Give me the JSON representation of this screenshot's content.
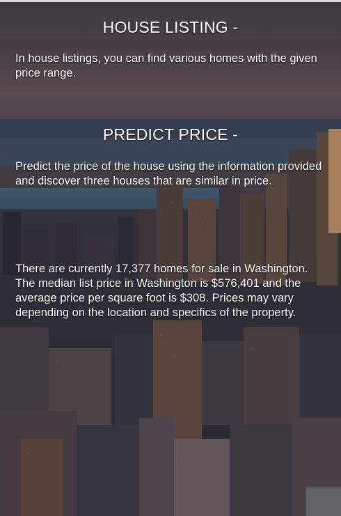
{
  "house_listing": {
    "heading": "HOUSE LISTING -",
    "description": "In house listings, you can find various homes with the given price range."
  },
  "predict_price": {
    "heading": "PREDICT PRICE -",
    "description": "Predict the price of the house using the information provided and discover three houses that are similar in price."
  },
  "market_info": {
    "text": "There are currently 17,377 homes for sale in Washington. The median list price in Washington is $576,401 and the average price per square foot is $308. Prices may vary depending on the location and specifics of the property."
  },
  "colors": {
    "header_band": "#4a3f46",
    "text": "#ffffff",
    "sky": "#3e3a42",
    "water": "#3f5a72"
  }
}
